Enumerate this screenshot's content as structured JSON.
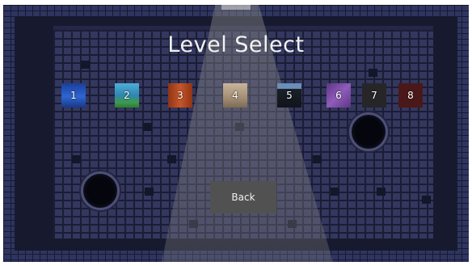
{
  "title": "Level Select",
  "levels": [
    {
      "label": "1",
      "color": "#2b5fc9"
    },
    {
      "label": "2",
      "color": "#3aa0b8"
    },
    {
      "label": "3",
      "color": "#b44a22"
    },
    {
      "label": "4",
      "color": "#a39078"
    },
    {
      "label": "5",
      "color": "#1e2630"
    },
    {
      "label": "6",
      "color": "#7a4ca0"
    },
    {
      "label": "7",
      "color": "#262629"
    },
    {
      "label": "8",
      "color": "#4a1818"
    }
  ],
  "back_label": "Back",
  "colors": {
    "background": "#1a1d33",
    "brick": "#34375e",
    "border_brick": "#2f3560",
    "button": "#515151",
    "title_text": "#f2f2f2"
  }
}
